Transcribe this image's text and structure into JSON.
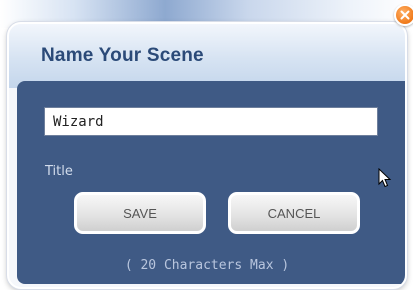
{
  "dialog": {
    "title": "Name Your Scene",
    "input_value": "Wizard",
    "field_label": "Title",
    "save_label": "SAVE",
    "cancel_label": "CANCEL",
    "hint": "( 20 Characters Max )"
  },
  "icons": {
    "close": "close-icon",
    "cursor": "mouse-pointer-icon"
  },
  "colors": {
    "panel": "#3f5a85",
    "title": "#2b4a78",
    "close_button": "#f07a1a"
  }
}
